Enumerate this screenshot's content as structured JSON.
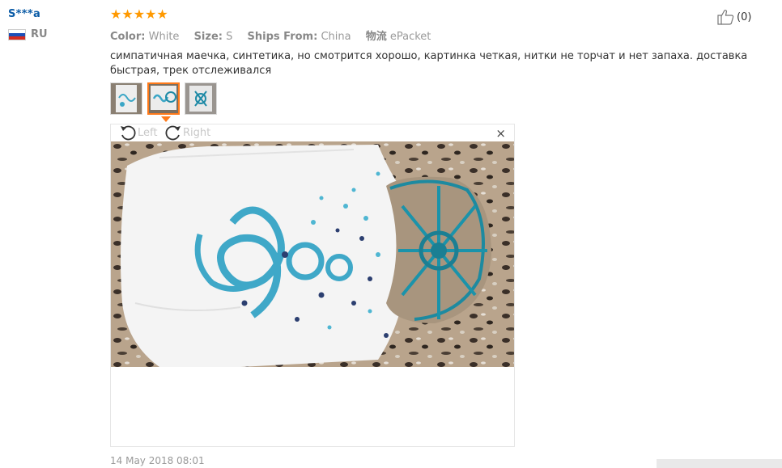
{
  "user": {
    "name": "S***a",
    "country": "RU"
  },
  "rating": {
    "stars": "★★★★★",
    "value": 5,
    "max": 5
  },
  "attributes": [
    {
      "label": "Color:",
      "value": "White"
    },
    {
      "label": "Size:",
      "value": "S"
    },
    {
      "label": "Ships From:",
      "value": "China"
    },
    {
      "label": "物流",
      "value": "ePacket"
    }
  ],
  "review_text": "симпатичная маечка, синтетика, но смотрится хорошо, картинка четкая, нитки не торчат и нет запаха. доставка быстрая, трек отслеживался",
  "helpful": {
    "count": "(0)"
  },
  "viewer": {
    "rotate_left": "Left",
    "rotate_right": "Right",
    "close": "×"
  },
  "thumbnails": [
    {
      "index": 1,
      "active": false
    },
    {
      "index": 2,
      "active": true
    },
    {
      "index": 3,
      "active": false
    }
  ],
  "date": "14 May 2018 08:01",
  "colors": {
    "accent": "#ff9900",
    "link": "#0a5ba6",
    "active_thumb": "#ff7a1a"
  }
}
